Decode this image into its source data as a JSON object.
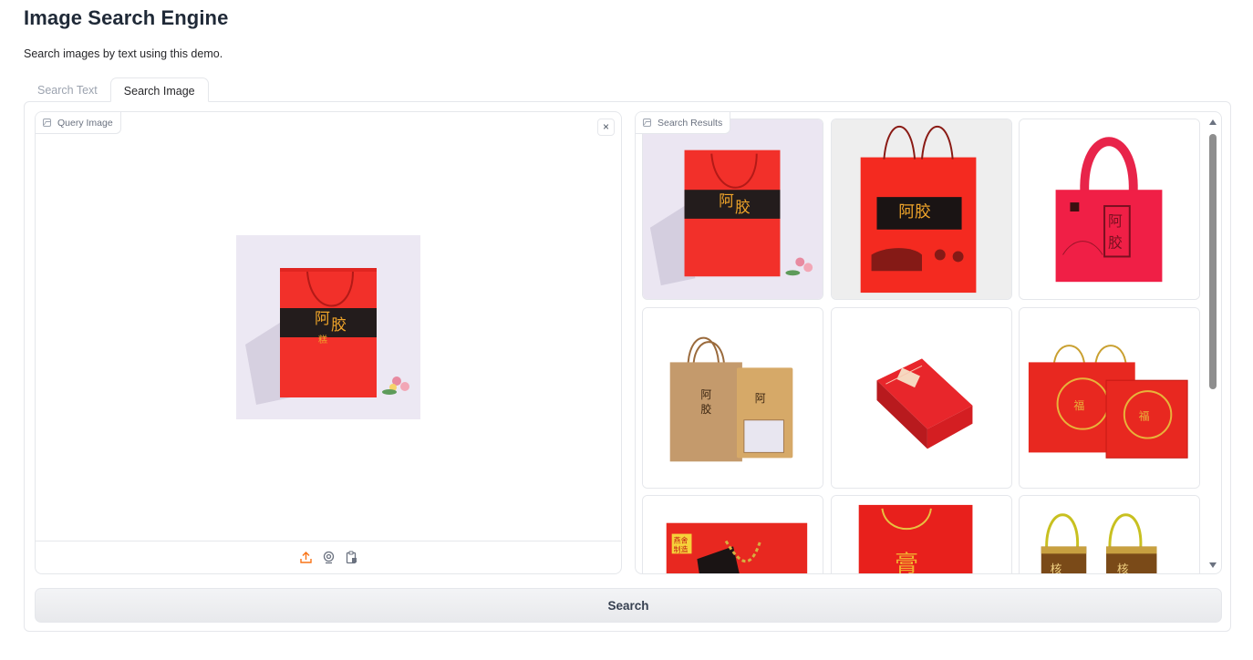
{
  "header": {
    "title": "Image Search Engine",
    "description": "Search images by text using this demo."
  },
  "tabs": [
    {
      "label": "Search Text",
      "active": false
    },
    {
      "label": "Search Image",
      "active": true
    }
  ],
  "query": {
    "label": "Query Image",
    "label_icon": "image-icon",
    "close_icon": "close-icon",
    "close_glyph": "×",
    "tools": [
      "upload-icon",
      "webcam-icon",
      "clipboard-icon"
    ]
  },
  "results": {
    "label": "Search Results",
    "label_icon": "image-icon",
    "items": [
      {
        "image": "red-gift-bag-with-flower"
      },
      {
        "image": "red-bag-with-black-band"
      },
      {
        "image": "pink-tote-bag"
      },
      {
        "image": "kraft-paper-bags"
      },
      {
        "image": "red-gift-box"
      },
      {
        "image": "red-bag-and-box-set"
      },
      {
        "image": "red-bag-gold-rope"
      },
      {
        "image": "red-bag-calligraphy"
      },
      {
        "image": "brown-gold-bags"
      }
    ]
  },
  "actions": {
    "search_label": "Search"
  },
  "colors": {
    "accent": "#f97316",
    "border": "#e5e7eb",
    "bag_red": "#f2302a",
    "text": "#1f2937"
  }
}
